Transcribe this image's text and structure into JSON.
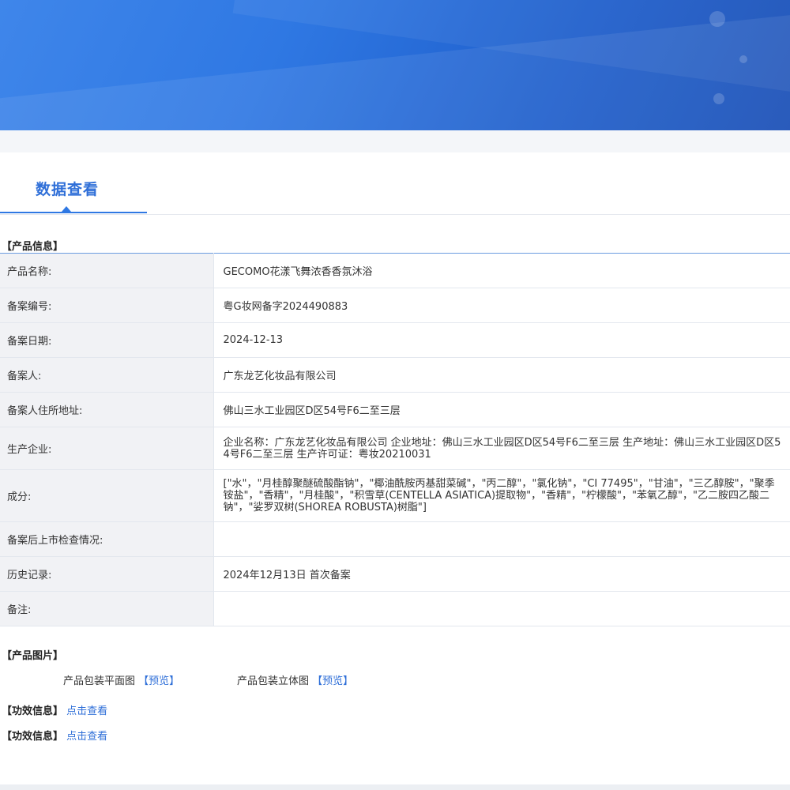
{
  "tab": {
    "label": "数据查看"
  },
  "product_info": {
    "title": "【产品信息】",
    "rows": [
      {
        "label": "产品名称:",
        "value": "GECOMO花漾飞舞浓香香氛沐浴"
      },
      {
        "label": "备案编号:",
        "value": "粤G妆网备字2024490883"
      },
      {
        "label": "备案日期:",
        "value": "2024-12-13"
      },
      {
        "label": "备案人:",
        "value": "广东龙艺化妆品有限公司"
      },
      {
        "label": "备案人住所地址:",
        "value": "佛山三水工业园区D区54号F6二至三层"
      },
      {
        "label": "生产企业:",
        "value": "企业名称：广东龙艺化妆品有限公司 企业地址：佛山三水工业园区D区54号F6二至三层 生产地址：佛山三水工业园区D区54号F6二至三层 生产许可证：粤妆20210031"
      },
      {
        "label": "成分:",
        "value": "[\"水\"，\"月桂醇聚醚硫酸酯钠\"，\"椰油酰胺丙基甜菜碱\"，\"丙二醇\"，\"氯化钠\"，\"CI 77495\"，\"甘油\"，\"三乙醇胺\"，\"聚季铵盐\"，\"香精\"，\"月桂酸\"，\"积雪草(CENTELLA ASIATICA)提取物\"，\"香精\"，\"柠檬酸\"，\"苯氧乙醇\"，\"乙二胺四乙酸二钠\"，\"娑罗双树(SHOREA ROBUSTA)树脂\"]"
      },
      {
        "label": "备案后上市检查情况:",
        "value": ""
      },
      {
        "label": "历史记录:",
        "value": "2024年12月13日 首次备案"
      },
      {
        "label": "备注:",
        "value": ""
      }
    ]
  },
  "product_images": {
    "title": "【产品图片】",
    "flat_label": "产品包装平面图",
    "flat_link": "【预览】",
    "solid_label": "产品包装立体图",
    "solid_link": "【预览】"
  },
  "report_1": {
    "title": "【功效信息】",
    "link": "点击查看"
  },
  "report_2": {
    "title": "【功效信息】",
    "link": "点击查看"
  },
  "colors": {
    "banner": "#2f78e3",
    "accent": "#2f6fd8",
    "label_bg": "#f1f2f5"
  }
}
